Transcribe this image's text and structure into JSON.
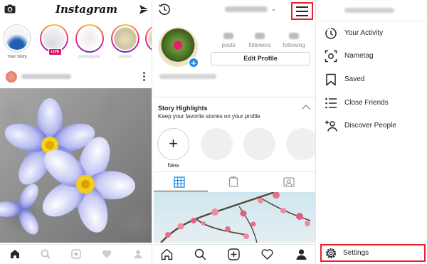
{
  "feed": {
    "logo": "Instagram",
    "stories": [
      {
        "label": "Your Story",
        "blurred": false
      },
      {
        "label": "",
        "blurred": true,
        "live": "LIVE"
      },
      {
        "label": "justinegutar",
        "blurred": true
      },
      {
        "label": "ashole",
        "blurred": true
      },
      {
        "label": "be",
        "blurred": true
      }
    ]
  },
  "profile": {
    "stats": [
      {
        "label": "posts"
      },
      {
        "label": "followers"
      },
      {
        "label": "following"
      }
    ],
    "edit_button": "Edit Profile",
    "highlights_title": "Story Highlights",
    "highlights_subtitle": "Keep your favorite stories on your profile",
    "new_label": "New",
    "new_symbol": "+"
  },
  "menu": {
    "items": [
      {
        "label": "Your Activity",
        "icon": "activity-icon"
      },
      {
        "label": "Nametag",
        "icon": "nametag-icon"
      },
      {
        "label": "Saved",
        "icon": "bookmark-icon"
      },
      {
        "label": "Close Friends",
        "icon": "close-friends-icon"
      },
      {
        "label": "Discover People",
        "icon": "add-person-icon"
      }
    ],
    "settings_label": "Settings"
  },
  "colors": {
    "highlight_red": "#e8222d",
    "add_blue": "#1e88e5",
    "live_pink": "#e0175d"
  }
}
